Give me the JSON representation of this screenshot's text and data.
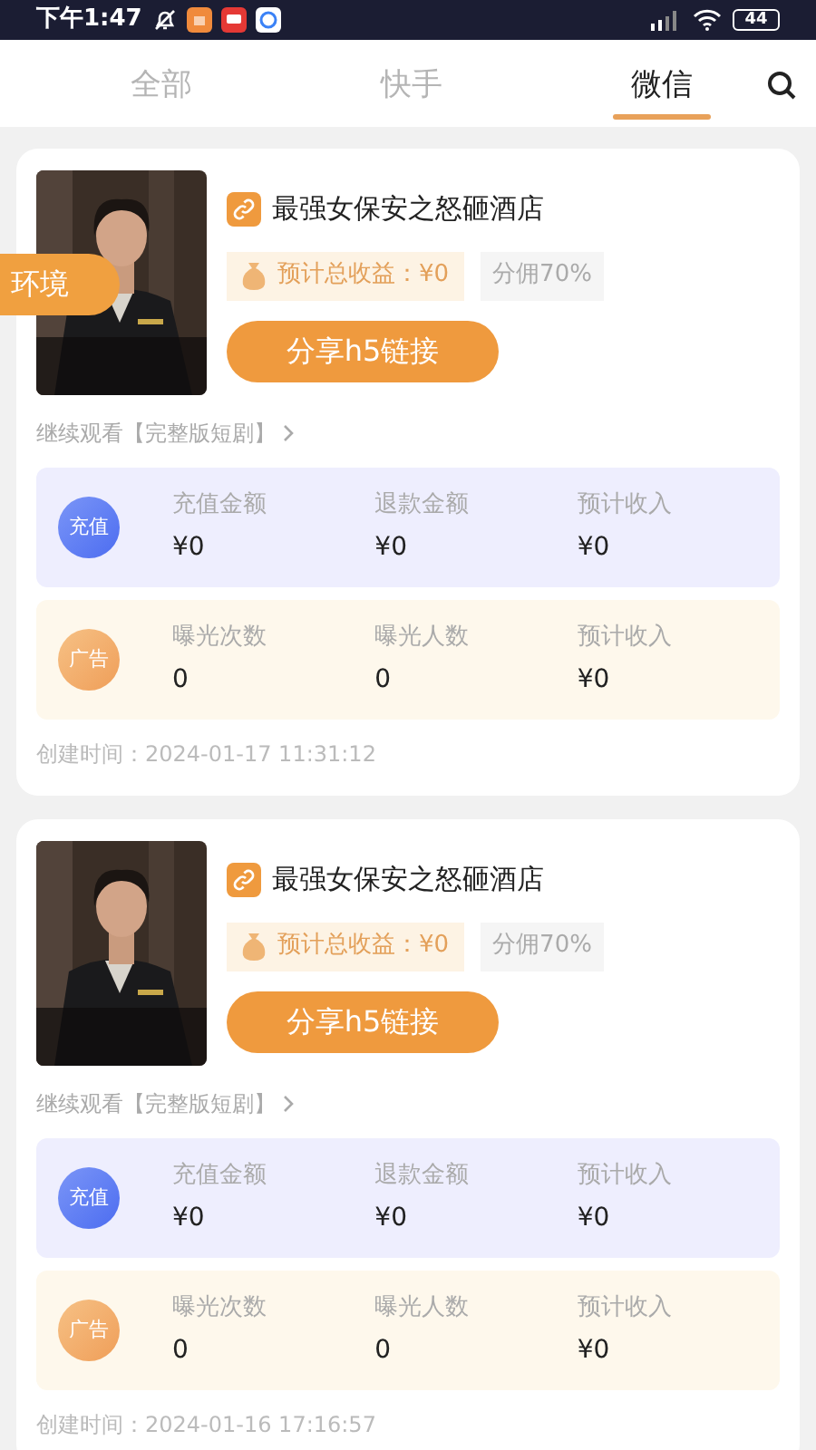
{
  "status_bar": {
    "time": "下午1:47",
    "battery": "44"
  },
  "tabs": [
    {
      "label": "全部",
      "selected": false
    },
    {
      "label": "快手",
      "selected": false
    },
    {
      "label": "微信",
      "selected": true
    }
  ],
  "badge": "环境",
  "cards": [
    {
      "title": "最强女保安之怒砸酒店",
      "earnings": "预计总收益：¥0",
      "commission": "分佣70%",
      "share_button": "分享h5链接",
      "continue_link": "继续观看【完整版短剧】",
      "stats": [
        {
          "kind": "recharge",
          "badge": "充值",
          "items": [
            {
              "label": "充值金额",
              "value": "¥0"
            },
            {
              "label": "退款金额",
              "value": "¥0"
            },
            {
              "label": "预计收入",
              "value": "¥0"
            }
          ]
        },
        {
          "kind": "ad",
          "badge": "广告",
          "items": [
            {
              "label": "曝光次数",
              "value": "0"
            },
            {
              "label": "曝光人数",
              "value": "0"
            },
            {
              "label": "预计收入",
              "value": "¥0"
            }
          ]
        }
      ],
      "created": "创建时间：2024-01-17 11:31:12"
    },
    {
      "title": "最强女保安之怒砸酒店",
      "earnings": "预计总收益：¥0",
      "commission": "分佣70%",
      "share_button": "分享h5链接",
      "continue_link": "继续观看【完整版短剧】",
      "stats": [
        {
          "kind": "recharge",
          "badge": "充值",
          "items": [
            {
              "label": "充值金额",
              "value": "¥0"
            },
            {
              "label": "退款金额",
              "value": "¥0"
            },
            {
              "label": "预计收入",
              "value": "¥0"
            }
          ]
        },
        {
          "kind": "ad",
          "badge": "广告",
          "items": [
            {
              "label": "曝光次数",
              "value": "0"
            },
            {
              "label": "曝光人数",
              "value": "0"
            },
            {
              "label": "预计收入",
              "value": "¥0"
            }
          ]
        }
      ],
      "created": "创建时间：2024-01-16 17:16:57"
    }
  ]
}
